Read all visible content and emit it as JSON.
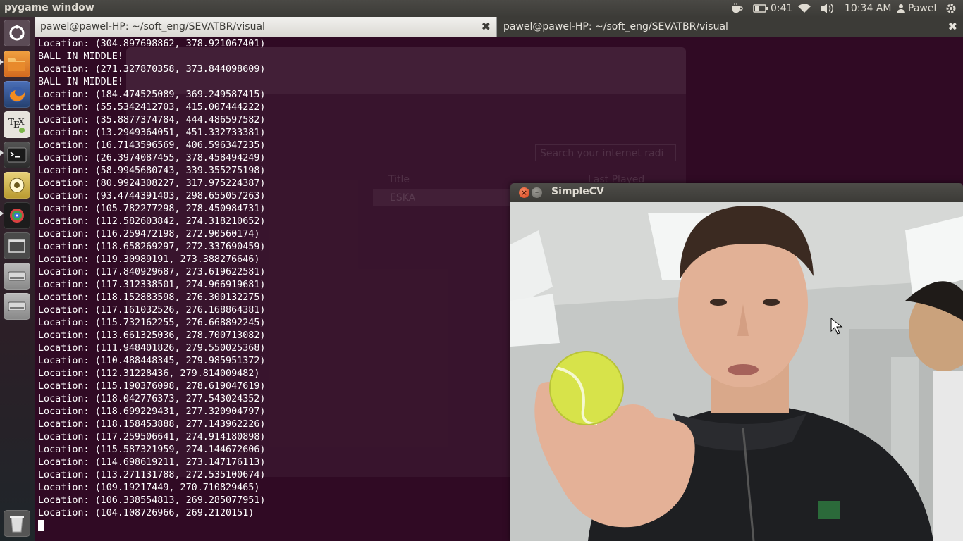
{
  "top_panel": {
    "app_title": "pygame window",
    "battery_time": "0:41",
    "clock": "10:34 AM",
    "user": "Pawel",
    "icons": [
      "coffee-cup-icon",
      "battery-icon",
      "wifi-icon",
      "volume-icon",
      "user-icon",
      "gear-icon"
    ]
  },
  "launcher": {
    "items": [
      "dash-home",
      "files",
      "firefox",
      "texmaker",
      "terminal",
      "rhythmbox",
      "simplecv-app",
      "workspace-switcher",
      "disk-drive",
      "disk-drive-2",
      "trash"
    ]
  },
  "tabs": [
    {
      "label": "pawel@pawel-HP: ~/soft_eng/SEVATBR/visual"
    },
    {
      "label": "pawel@pawel-HP: ~/soft_eng/SEVATBR/visual"
    }
  ],
  "background_window": {
    "search_placeholder": "Search your internet radi",
    "col_title": "Title",
    "col_last_played": "Last Played",
    "row_1": "ESKA"
  },
  "terminal": {
    "lines": [
      "Location: (304.897698862, 378.921067401)",
      "BALL IN MIDDLE!",
      "Location: (271.327870358, 373.844098609)",
      "BALL IN MIDDLE!",
      "Location: (184.474525089, 369.249587415)",
      "Location: (55.5342412703, 415.007444222)",
      "Location: (35.8877374784, 444.486597582)",
      "Location: (13.2949364051, 451.332733381)",
      "Location: (16.7143596569, 406.596347235)",
      "Location: (26.3974087455, 378.458494249)",
      "Location: (58.9945680743, 339.355275198)",
      "Location: (80.9924308227, 317.975224387)",
      "Location: (93.4744391403, 298.655057263)",
      "Location: (105.782277298, 278.450984731)",
      "Location: (112.582603842, 274.318210652)",
      "Location: (116.259472198, 272.90560174)",
      "Location: (118.658269297, 272.337690459)",
      "Location: (119.30989191, 273.388276646)",
      "Location: (117.840929687, 273.619622581)",
      "Location: (117.312338501, 274.966919681)",
      "Location: (118.152883598, 276.300132275)",
      "Location: (117.161032526, 276.168864381)",
      "Location: (115.732162255, 276.668892245)",
      "Location: (113.661325036, 278.700713082)",
      "Location: (111.948401826, 279.550025368)",
      "Location: (110.488448345, 279.985951372)",
      "Location: (112.31228436, 279.814009482)",
      "Location: (115.190376098, 278.619047619)",
      "Location: (118.042776373, 277.543024352)",
      "Location: (118.699229431, 277.320904797)",
      "Location: (118.158453888, 277.143962226)",
      "Location: (117.259506641, 274.914180898)",
      "Location: (115.587321959, 274.144672606)",
      "Location: (114.698619211, 273.147176113)",
      "Location: (113.271131788, 272.535100674)",
      "Location: (109.19217449, 270.710829465)",
      "Location: (106.338554813, 269.285077951)",
      "Location: (104.108726966, 269.2120151)"
    ]
  },
  "simplecv": {
    "title": "SimpleCV",
    "close_glyph": "×",
    "min_glyph": "–"
  },
  "colors": {
    "terminal_bg": "#300a24",
    "panel_bg": "#3c3b37",
    "close_orange": "#e35c2f",
    "ball_yellow": "#d7e34a"
  }
}
